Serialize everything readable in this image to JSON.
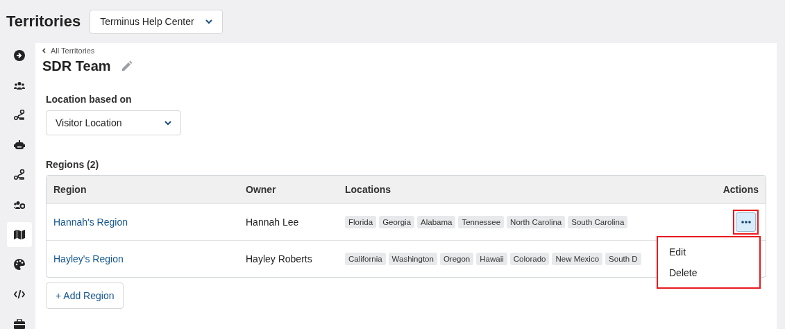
{
  "header": {
    "title": "Territories",
    "workspace_select": {
      "value": "Terminus Help Center"
    }
  },
  "sidebar": {
    "items": [
      {
        "selected": false
      },
      {
        "selected": false
      },
      {
        "selected": false
      },
      {
        "selected": false
      },
      {
        "selected": false
      },
      {
        "selected": false
      },
      {
        "selected": true
      },
      {
        "selected": false
      },
      {
        "selected": false
      },
      {
        "selected": false
      }
    ]
  },
  "back_link": "All Territories",
  "title": "SDR Team",
  "location_field": {
    "label": "Location based on",
    "value": "Visitor Location"
  },
  "regions": {
    "heading": "Regions (2)",
    "columns": [
      "Region",
      "Owner",
      "Locations",
      "Actions"
    ],
    "rows": [
      {
        "region": "Hannah's Region",
        "owner": "Hannah Lee",
        "locations": [
          "Florida",
          "Georgia",
          "Alabama",
          "Tennessee",
          "North Carolina",
          "South Carolina"
        ],
        "menu_open": true
      },
      {
        "region": "Hayley's Region",
        "owner": "Hayley Roberts",
        "locations": [
          "California",
          "Washington",
          "Oregon",
          "Hawaii",
          "Colorado",
          "New Mexico",
          "South D"
        ],
        "menu_open": false
      }
    ],
    "menu": {
      "highlighted": true,
      "items": [
        "Edit",
        "Delete"
      ]
    },
    "add_button": "+ Add Region"
  }
}
